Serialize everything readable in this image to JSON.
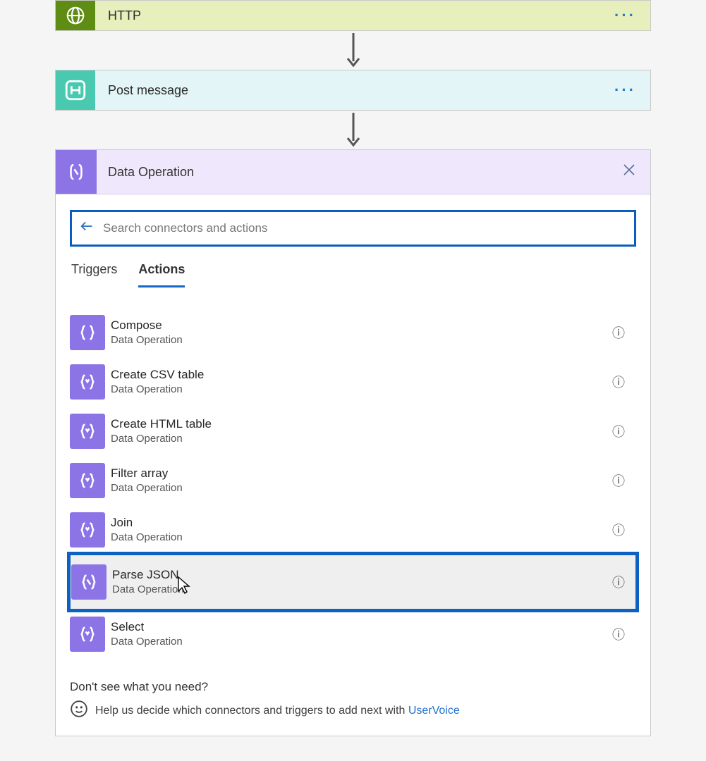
{
  "steps": {
    "http": {
      "title": "HTTP"
    },
    "post": {
      "title": "Post message"
    }
  },
  "panel": {
    "title": "Data Operation"
  },
  "search": {
    "placeholder": "Search connectors and actions"
  },
  "tabs": {
    "triggers": "Triggers",
    "actions": "Actions"
  },
  "actions": [
    {
      "title": "Compose",
      "sub": "Data Operation"
    },
    {
      "title": "Create CSV table",
      "sub": "Data Operation"
    },
    {
      "title": "Create HTML table",
      "sub": "Data Operation"
    },
    {
      "title": "Filter array",
      "sub": "Data Operation"
    },
    {
      "title": "Join",
      "sub": "Data Operation"
    },
    {
      "title": "Parse JSON",
      "sub": "Data Operation"
    },
    {
      "title": "Select",
      "sub": "Data Operation"
    }
  ],
  "footer": {
    "prompt": "Don't see what you need?",
    "help_text": "Help us decide which connectors and triggers to add next with ",
    "link": "UserVoice"
  }
}
